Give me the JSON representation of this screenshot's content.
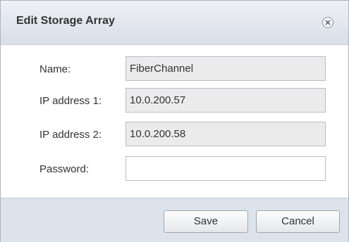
{
  "dialog": {
    "title": "Edit Storage Array",
    "close_icon": "close-circle-icon"
  },
  "form": {
    "name": {
      "label": "Name:",
      "value": "FiberChannel"
    },
    "ip1": {
      "label": "IP address 1:",
      "value": "10.0.200.57"
    },
    "ip2": {
      "label": "IP address 2:",
      "value": "10.0.200.58"
    },
    "password": {
      "label": "Password:",
      "value": ""
    }
  },
  "buttons": {
    "save": "Save",
    "cancel": "Cancel"
  },
  "colors": {
    "titlebar": "#dde2ea",
    "footer": "#dde3eb",
    "readonly_field": "#ebebeb"
  }
}
